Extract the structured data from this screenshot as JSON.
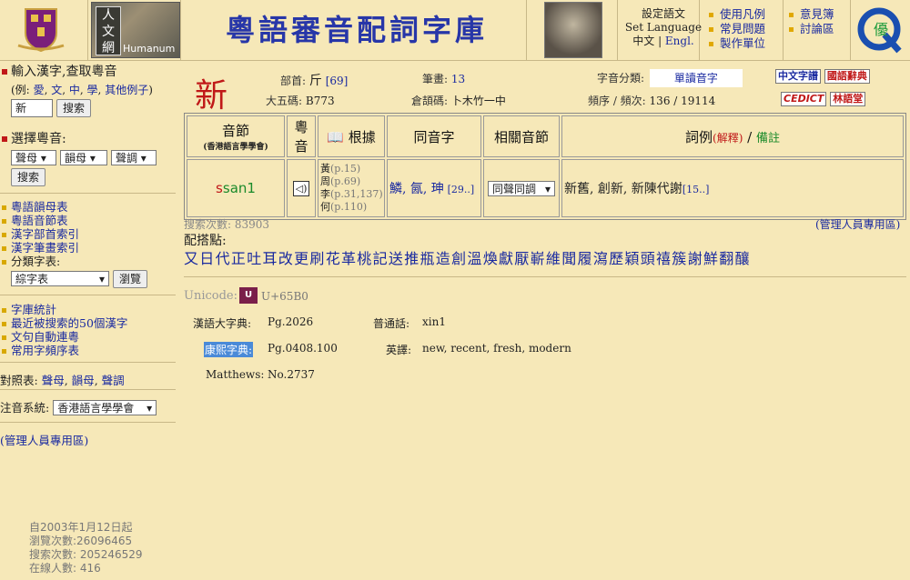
{
  "header": {
    "site_title": "粵語審音配詞字庫",
    "lang_set": "設定語文",
    "lang_set_en": "Set Language",
    "lang_zh": "中文",
    "lang_en": "Engl.",
    "nav1": [
      "使用凡例",
      "常見問題",
      "製作單位"
    ],
    "nav2": [
      "意見簿",
      "討論區"
    ],
    "humanum_text": "Humanum"
  },
  "sidebar": {
    "input_title": "輸入漢字,查取粵音",
    "example_prefix": "(例:",
    "examples": [
      "愛",
      "文",
      "中",
      "學",
      "其他例子"
    ],
    "example_suffix": ")",
    "char_input_value": "新",
    "search_btn": "搜索",
    "choose_title": "選擇粵音:",
    "sel_initial": "聲母",
    "sel_final": "韻母",
    "sel_tone": "聲調",
    "search_btn2": "搜索",
    "links1": [
      "粵語韻母表",
      "粵語音節表",
      "漢字部首索引",
      "漢字筆畫索引"
    ],
    "classify_label": "分類字表:",
    "classify_value": "綜字表",
    "browse_btn": "瀏覽",
    "links2": [
      "字庫統計",
      "最近被搜索的50個漢字",
      "文句自動連粵",
      "常用字頻序表"
    ],
    "compare_label": "對照表:",
    "compare_links": [
      "聲母",
      "韻母",
      "聲調"
    ],
    "phon_label": "注音系統:",
    "phon_value": "香港語言學學會",
    "admin": "(管理人員專用區)",
    "since": "自2003年1月12日起",
    "views": "瀏覽次數:26096465",
    "searches": "搜索次數: 205246529",
    "online": "在線人數: 416"
  },
  "char": {
    "glyph": "新",
    "radical_label": "部首:",
    "radical": "斤",
    "radical_num": "[69]",
    "strokes_label": "筆畫:",
    "strokes": "13",
    "class_label": "字音分類:",
    "class_value": "單讀音字",
    "big5_label": "大五碼:",
    "big5": "B773",
    "cangjie_label": "倉頡碼:",
    "cangjie": "卜木竹一中",
    "freq_label": "頻序 / 頻次:",
    "freq": "136 / 19114",
    "tag1": "中文字譜",
    "tag2": "國語辭典",
    "tag3": "CEDICT",
    "tag4": "林語堂"
  },
  "table": {
    "h_syllable": "音節",
    "h_syllable_sub": "(香港語言學學會)",
    "h_yue": "粵",
    "h_yue2": "音",
    "h_basis": "根據",
    "h_homo": "同音字",
    "h_related": "相關音節",
    "h_words": "詞例",
    "h_words_expl": "(解釋)",
    "h_words_sep": " / ",
    "h_words_note": "備註",
    "syllable": "san1",
    "basis": [
      "黃",
      "周",
      "李",
      "何"
    ],
    "basis_pages": [
      "(p.15)",
      "(p.69)",
      "(p.31,137)",
      "(p.110)"
    ],
    "homophones": "鱗, 氤, 珅",
    "homophones_more": "[29..]",
    "related_value": "同聲同調",
    "words": "新舊, 創新, 新陳代謝",
    "words_more": "[15..]"
  },
  "below": {
    "search_count": "搜索次數: 83903",
    "admin": "(管理人員專用區)",
    "pairs_label": "配搭點:",
    "pairs": "又日代正吐耳改更刷花革桃記送推瓶造創溫煥獻厭嶄維聞履瀉歷穎頭禧簇謝鮮翻釀"
  },
  "unicode": {
    "label": "Unicode:",
    "code": "U+65B0",
    "hydzd_label": "漢語大字典:",
    "hydzd": "Pg.2026",
    "pth_label": "普通話:",
    "pth": "xin1",
    "kangxi_label": "康熙字典:",
    "kangxi": "Pg.0408.100",
    "eng_label": "英譯:",
    "eng": "new, recent, fresh, modern",
    "matthews_label": "Matthews:",
    "matthews": "No.2737"
  },
  "colors": {
    "background": "#f6e8b8",
    "link": "#1a2aa0",
    "accent_red": "#c01818",
    "bullet": "#d8a800"
  }
}
